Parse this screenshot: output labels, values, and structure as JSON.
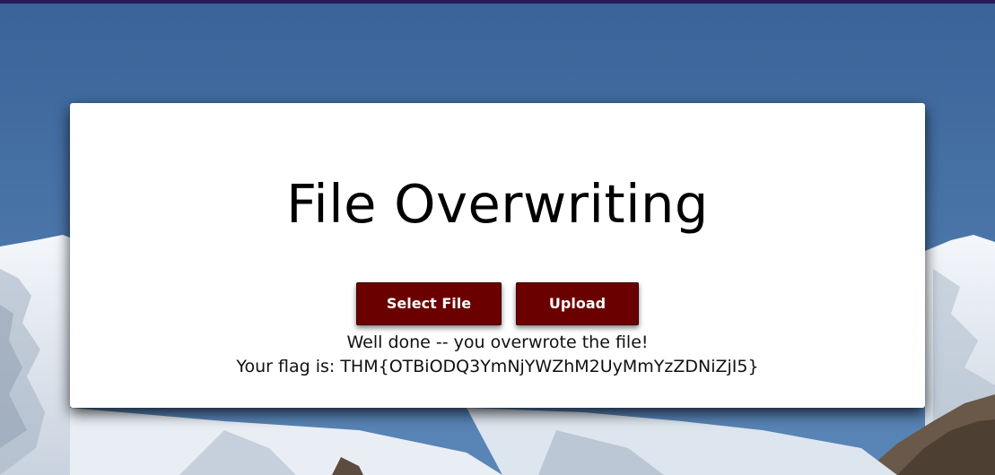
{
  "page": {
    "title": "File Overwriting",
    "buttons": {
      "select_file": "Select File",
      "upload": "Upload"
    },
    "messages": {
      "success": "Well done -- you overwrote the file!",
      "flag_label": "Your flag is: ",
      "flag_value": "THM{OTBiODQ3YmNjYWZhM2UyMmYzZDNiZjI5}"
    }
  },
  "colors": {
    "sky": "#3e6a9f",
    "top_border": "#2b1a5c",
    "button": "#6b0000",
    "card": "#ffffff"
  },
  "background": {
    "icon": "snowy-mountain-landscape"
  }
}
